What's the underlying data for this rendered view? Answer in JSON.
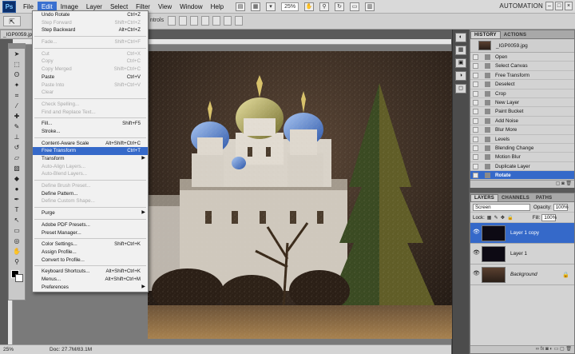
{
  "menubar": {
    "logo": "Ps",
    "menus": [
      "File",
      "Edit",
      "Image",
      "Layer",
      "Select",
      "Filter",
      "View",
      "Window",
      "Help"
    ],
    "zoom": "25%",
    "workspace": "AUTOMATION",
    "window_buttons": [
      "–",
      "□",
      "×"
    ]
  },
  "options_bar": {
    "fragment": "ntrols"
  },
  "document": {
    "tab_label": "_IGP0059.jpg",
    "status_zoom": "25%",
    "status_doc": "Doc: 27.7M/83.1M"
  },
  "edit_menu": [
    {
      "label": "Undo Rotate",
      "shortcut": "Ctrl+Z",
      "enabled": true
    },
    {
      "label": "Step Forward",
      "shortcut": "Shift+Ctrl+Z",
      "enabled": false
    },
    {
      "label": "Step Backward",
      "shortcut": "Alt+Ctrl+Z",
      "enabled": true
    },
    {
      "sep": true
    },
    {
      "label": "Fade...",
      "shortcut": "Shift+Ctrl+F",
      "enabled": false
    },
    {
      "sep": true
    },
    {
      "label": "Cut",
      "shortcut": "Ctrl+X",
      "enabled": false
    },
    {
      "label": "Copy",
      "shortcut": "Ctrl+C",
      "enabled": false
    },
    {
      "label": "Copy Merged",
      "shortcut": "Shift+Ctrl+C",
      "enabled": false
    },
    {
      "label": "Paste",
      "shortcut": "Ctrl+V",
      "enabled": true
    },
    {
      "label": "Paste Into",
      "shortcut": "Shift+Ctrl+V",
      "enabled": false
    },
    {
      "label": "Clear",
      "shortcut": "",
      "enabled": false
    },
    {
      "sep": true
    },
    {
      "label": "Check Spelling...",
      "shortcut": "",
      "enabled": false
    },
    {
      "label": "Find and Replace Text...",
      "shortcut": "",
      "enabled": false
    },
    {
      "sep": true
    },
    {
      "label": "Fill...",
      "shortcut": "Shift+F5",
      "enabled": true
    },
    {
      "label": "Stroke...",
      "shortcut": "",
      "enabled": true
    },
    {
      "sep": true
    },
    {
      "label": "Content-Aware Scale",
      "shortcut": "Alt+Shift+Ctrl+C",
      "enabled": true
    },
    {
      "label": "Free Transform",
      "shortcut": "Ctrl+T",
      "enabled": true,
      "highlighted": true
    },
    {
      "label": "Transform",
      "shortcut": "",
      "enabled": true,
      "submenu": true
    },
    {
      "label": "Auto-Align Layers...",
      "shortcut": "",
      "enabled": false
    },
    {
      "label": "Auto-Blend Layers...",
      "shortcut": "",
      "enabled": false
    },
    {
      "sep": true
    },
    {
      "label": "Define Brush Preset...",
      "shortcut": "",
      "enabled": false
    },
    {
      "label": "Define Pattern...",
      "shortcut": "",
      "enabled": true
    },
    {
      "label": "Define Custom Shape...",
      "shortcut": "",
      "enabled": false
    },
    {
      "sep": true
    },
    {
      "label": "Purge",
      "shortcut": "",
      "enabled": true,
      "submenu": true
    },
    {
      "sep": true
    },
    {
      "label": "Adobe PDF Presets...",
      "shortcut": "",
      "enabled": true
    },
    {
      "label": "Preset Manager...",
      "shortcut": "",
      "enabled": true
    },
    {
      "sep": true
    },
    {
      "label": "Color Settings...",
      "shortcut": "Shift+Ctrl+K",
      "enabled": true
    },
    {
      "label": "Assign Profile...",
      "shortcut": "",
      "enabled": true
    },
    {
      "label": "Convert to Profile...",
      "shortcut": "",
      "enabled": true
    },
    {
      "sep": true
    },
    {
      "label": "Keyboard Shortcuts...",
      "shortcut": "Alt+Shift+Ctrl+K",
      "enabled": true
    },
    {
      "label": "Menus...",
      "shortcut": "Alt+Shift+Ctrl+M",
      "enabled": true
    },
    {
      "label": "Preferences",
      "shortcut": "",
      "enabled": true,
      "submenu": true
    }
  ],
  "history_panel": {
    "tabs": [
      "HISTORY",
      "ACTIONS"
    ],
    "snapshot": "_IGP0059.jpg",
    "states": [
      "Open",
      "Select Canvas",
      "Free Transform",
      "Deselect",
      "Crop",
      "New Layer",
      "Paint Bucket",
      "Add Noise",
      "Blur More",
      "Levels",
      "Blending Change",
      "Motion Blur",
      "Duplicate Layer",
      "Rotate"
    ],
    "selected": "Rotate"
  },
  "layers_panel": {
    "tabs": [
      "LAYERS",
      "CHANNELS",
      "PATHS"
    ],
    "blend_mode": "Screen",
    "opacity_label": "Opacity:",
    "opacity": "100%",
    "lock_label": "Lock:",
    "fill_label": "Fill:",
    "fill": "100%",
    "layers": [
      {
        "name": "Layer 1 copy",
        "selected": true
      },
      {
        "name": "Layer 1",
        "selected": false
      },
      {
        "name": "Background",
        "selected": false,
        "locked": true
      }
    ]
  },
  "colors": {
    "highlight": "#3569c9",
    "menubar": "#d9d9d9",
    "panel": "#d3d3d3"
  }
}
